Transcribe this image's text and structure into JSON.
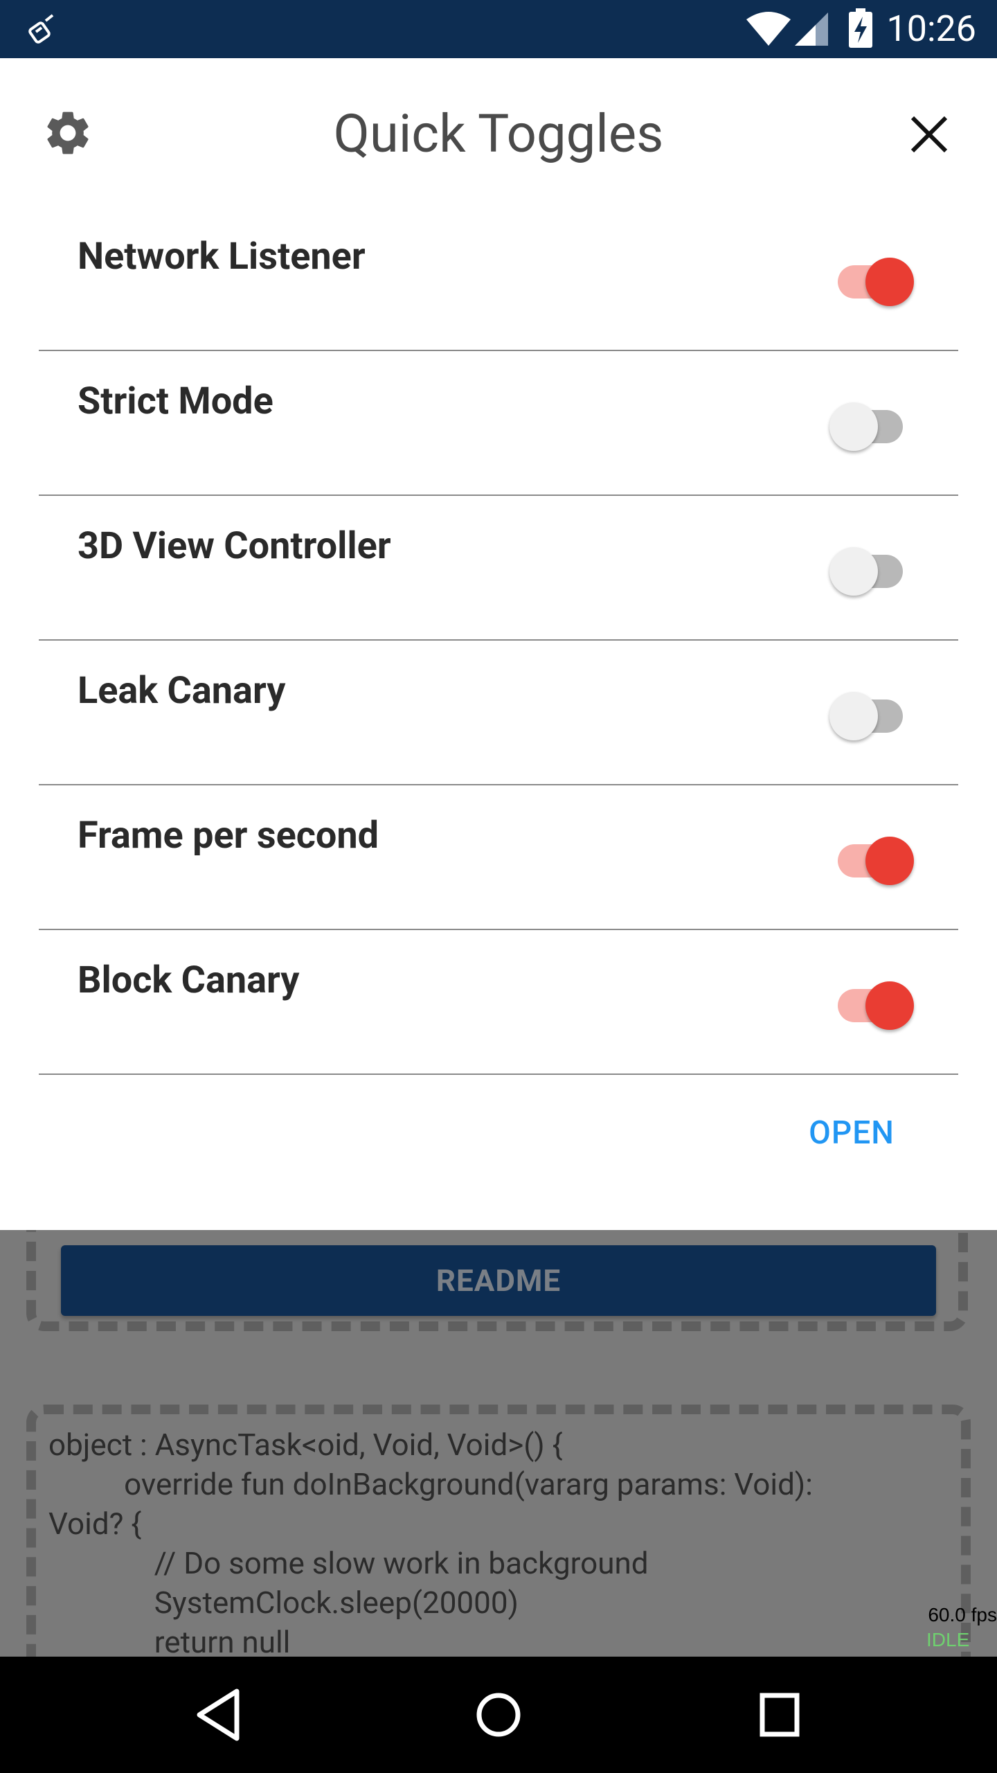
{
  "status_bar": {
    "time": "10:26"
  },
  "dialog": {
    "title": "Quick Toggles",
    "toggles": [
      {
        "label": "Network Listener",
        "on": true
      },
      {
        "label": "Strict Mode",
        "on": false
      },
      {
        "label": "3D View Controller",
        "on": false
      },
      {
        "label": "Leak Canary",
        "on": false
      },
      {
        "label": "Frame per second",
        "on": true
      },
      {
        "label": "Block Canary",
        "on": true
      }
    ],
    "open_label": "OPEN"
  },
  "background_app": {
    "readme_label": "README",
    "code_lines": "object : AsyncTask<oid, Void, Void>() {\n          override fun doInBackground(vararg params: Void):\nVoid? {\n              // Do some slow work in background\n              SystemClock.sleep(20000)\n              return null",
    "fps": "60.0 fps",
    "idle": "IDLE"
  },
  "colors": {
    "accent": "#e93d33",
    "status_bar": "#0d2d52",
    "link": "#2196f3"
  }
}
